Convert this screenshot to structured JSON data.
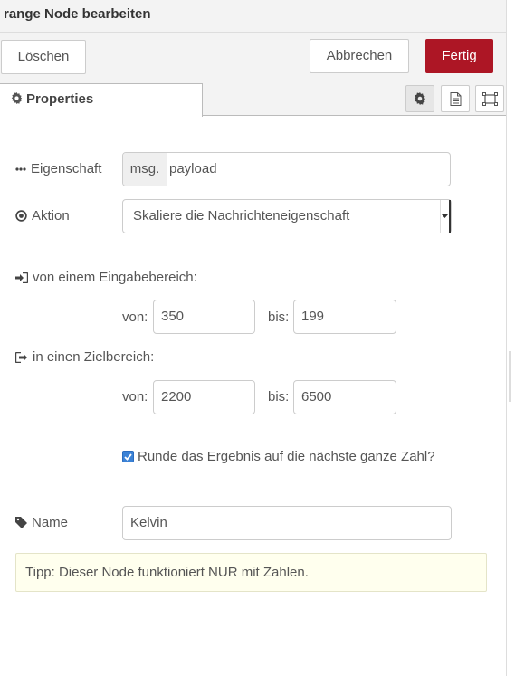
{
  "header": {
    "title": "range Node bearbeiten"
  },
  "toolbar": {
    "delete_label": "Löschen",
    "cancel_label": "Abbrechen",
    "done_label": "Fertig"
  },
  "tabs": {
    "properties_label": "Properties"
  },
  "form": {
    "property": {
      "label": "Eigenschaft",
      "prefix": "msg.",
      "value": "payload"
    },
    "action": {
      "label": "Aktion",
      "selected": "Skaliere die Nachrichteneigenschaft"
    },
    "input_range": {
      "label": "von einem Eingabebereich:",
      "from_label": "von:",
      "from_value": "350",
      "to_label": "bis:",
      "to_value": "199"
    },
    "target_range": {
      "label": "in einen Zielbereich:",
      "from_label": "von:",
      "from_value": "2200",
      "to_label": "bis:",
      "to_value": "6500"
    },
    "round": {
      "label": "Runde das Ergebnis auf die nächste ganze Zahl?",
      "checked": true
    },
    "name": {
      "label": "Name",
      "value": "Kelvin"
    }
  },
  "tip": {
    "text": "Tipp: Dieser Node funktioniert NUR mit Zahlen."
  },
  "colors": {
    "primary": "#ad1625",
    "checkbox": "#3b82d6",
    "tip_bg": "#ffffee"
  },
  "icons": [
    "gear-icon",
    "description-icon",
    "appearance-icon",
    "ellipsis-icon",
    "dot-circle-icon",
    "sign-in-icon",
    "sign-out-icon",
    "tag-icon",
    "caret-down-icon",
    "check-icon"
  ]
}
